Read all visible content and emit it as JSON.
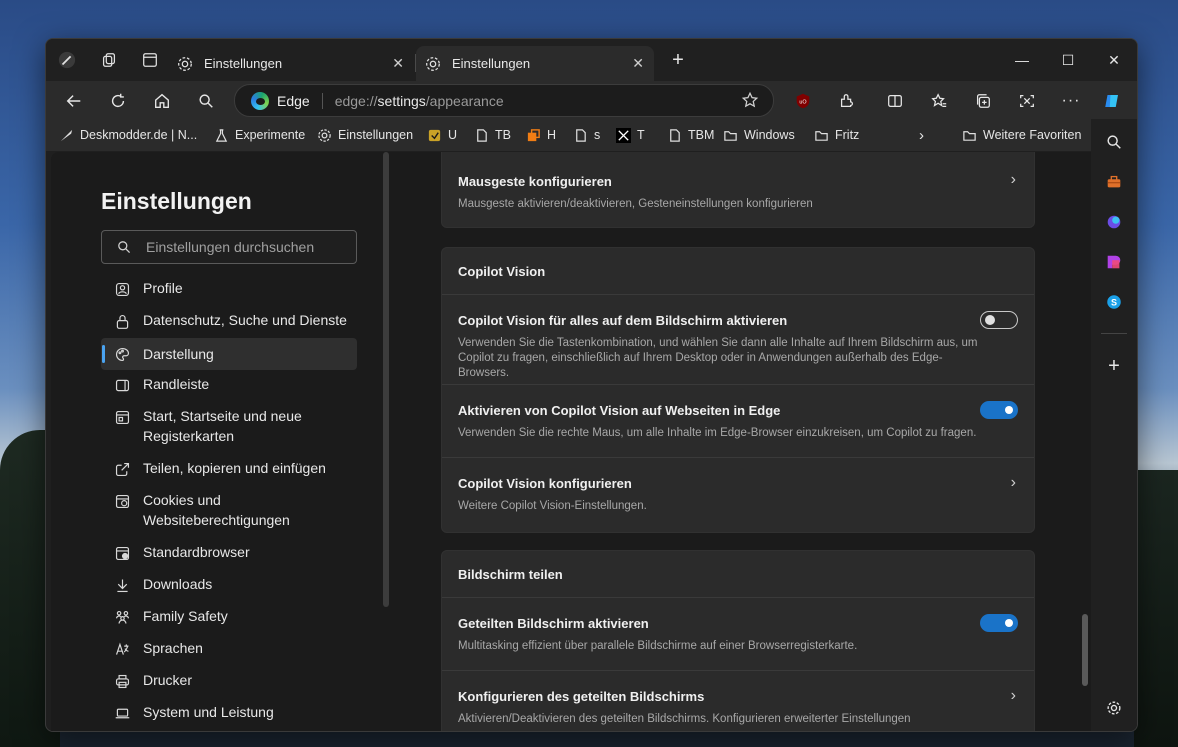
{
  "tabs": [
    {
      "label": "Einstellungen",
      "active": false
    },
    {
      "label": "Einstellungen",
      "active": true
    }
  ],
  "address": {
    "site": "Edge",
    "url_prefix": "edge://",
    "url_highlight": "settings",
    "url_suffix": "/appearance"
  },
  "bookmarks": [
    {
      "label": "Deskmodder.de | N...",
      "icon": "feather-icon"
    },
    {
      "label": "Experimente",
      "icon": "flask-icon"
    },
    {
      "label": "Einstellungen",
      "icon": "gear-icon"
    },
    {
      "label": "U",
      "icon": "extension-icon"
    },
    {
      "label": "TB",
      "icon": "page-icon"
    },
    {
      "label": "H",
      "icon": "h-icon"
    },
    {
      "label": "s",
      "icon": "page-icon"
    },
    {
      "label": "T",
      "icon": "x-logo-icon"
    },
    {
      "label": "TBM",
      "icon": "page-icon"
    },
    {
      "label": "Windows",
      "icon": "folder-icon"
    },
    {
      "label": "Fritz",
      "icon": "folder-icon"
    },
    {
      "label": "Weitere Favoriten",
      "icon": "folder-icon"
    }
  ],
  "settings": {
    "title": "Einstellungen",
    "search_placeholder": "Einstellungen durchsuchen",
    "nav": [
      {
        "label": "Profile",
        "icon": "profile-icon"
      },
      {
        "label": "Datenschutz, Suche und Dienste",
        "icon": "lock-icon"
      },
      {
        "label": "Darstellung",
        "icon": "palette-icon",
        "active": true
      },
      {
        "label": "Randleiste",
        "icon": "sidebar-icon"
      },
      {
        "label": "Start, Startseite und neue Registerkarten",
        "icon": "home-tabs-icon"
      },
      {
        "label": "Teilen, kopieren und einfügen",
        "icon": "share-icon"
      },
      {
        "label": "Cookies und Websiteberechtigungen",
        "icon": "cookie-icon"
      },
      {
        "label": "Standardbrowser",
        "icon": "browser-icon"
      },
      {
        "label": "Downloads",
        "icon": "download-icon"
      },
      {
        "label": "Family Safety",
        "icon": "family-icon"
      },
      {
        "label": "Sprachen",
        "icon": "language-icon"
      },
      {
        "label": "Drucker",
        "icon": "printer-icon"
      },
      {
        "label": "System und Leistung",
        "icon": "laptop-icon"
      }
    ]
  },
  "cards": {
    "mouse": {
      "title": "Mausgeste konfigurieren",
      "desc": "Mausgeste aktivieren/deaktivieren, Gesteneinstellungen konfigurieren"
    },
    "copilot": {
      "header": "Copilot Vision",
      "row1_title": "Copilot Vision für alles auf dem Bildschirm aktivieren",
      "row1_desc": "Verwenden Sie die Tastenkombination, und wählen Sie dann alle Inhalte auf Ihrem Bildschirm aus, um Copilot zu fragen, einschließlich auf Ihrem Desktop oder in Anwendungen außerhalb des Edge-Browsers.",
      "row1_toggle": "off",
      "row2_title": "Aktivieren von Copilot Vision auf Webseiten in Edge",
      "row2_desc": "Verwenden Sie die rechte Maus, um alle Inhalte im Edge-Browser einzukreisen, um Copilot zu fragen.",
      "row2_toggle": "on",
      "row3_title": "Copilot Vision konfigurieren",
      "row3_desc": "Weitere Copilot Vision-Einstellungen."
    },
    "split": {
      "header": "Bildschirm teilen",
      "row1_title": "Geteilten Bildschirm aktivieren",
      "row1_desc": "Multitasking effizient über parallele Bildschirme auf einer Browserregisterkarte.",
      "row1_toggle": "on",
      "row2_title": "Konfigurieren des geteilten Bildschirms",
      "row2_desc": "Aktivieren/Deaktivieren des geteilten Bildschirms. Konfigurieren erweiterter Einstellungen"
    }
  },
  "colors": {
    "accent": "#1a73c8",
    "active_indicator": "#4aa3f0"
  }
}
